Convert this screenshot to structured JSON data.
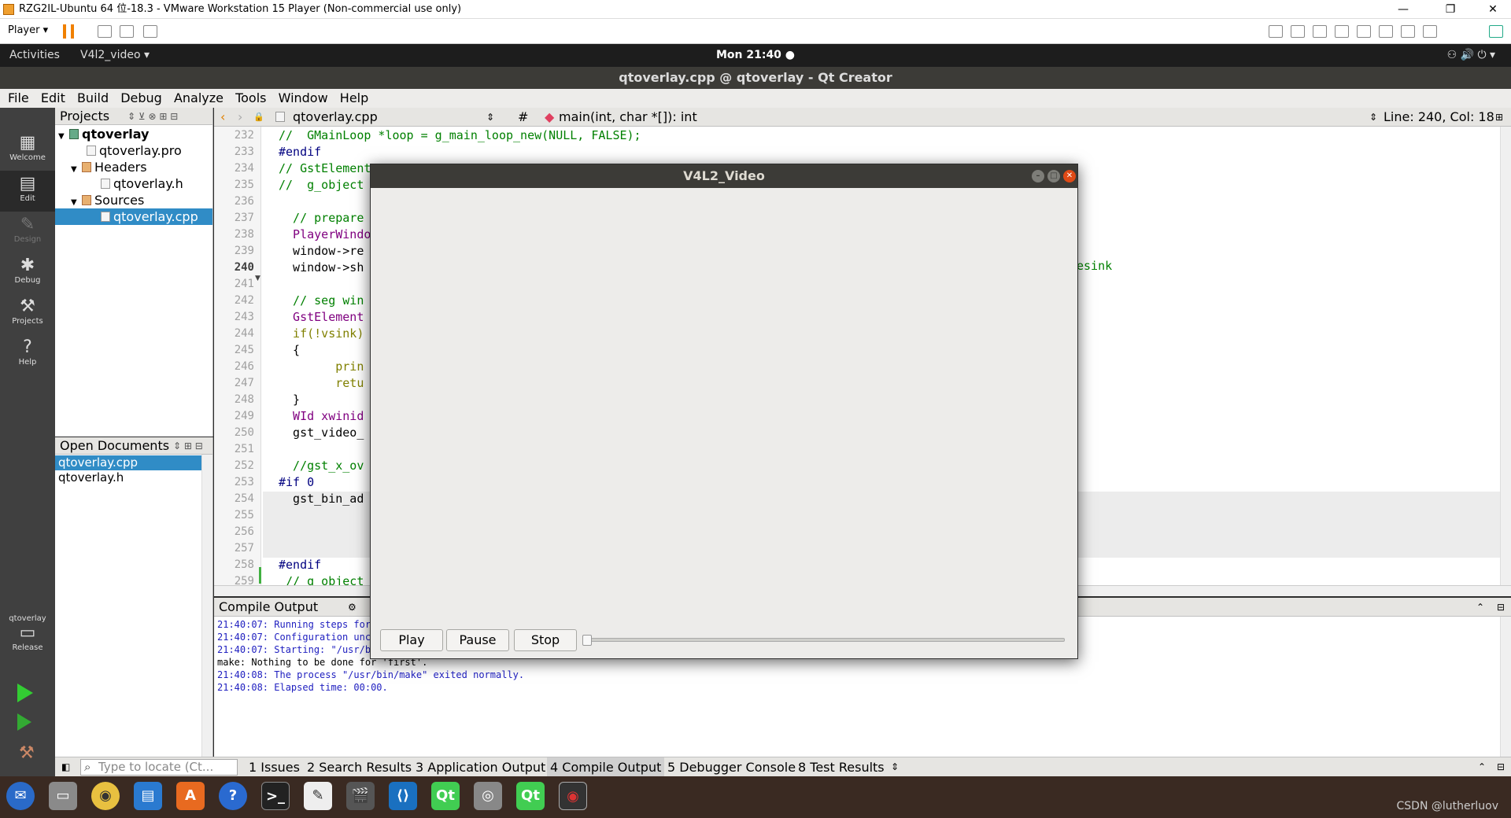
{
  "vm": {
    "title": "RZG2IL-Ubuntu 64 位-18.3 - VMware Workstation 15 Player (Non-commercial use only)",
    "player_label": "Player ▾",
    "minimize": "—",
    "restore": "❐",
    "close": "✕"
  },
  "gnome": {
    "activities": "Activities",
    "app_menu": "V4l2_video ▾",
    "clock": "Mon 21:40 ●",
    "tray": "⚇  🔊  ⏻ ▾"
  },
  "qt": {
    "window_title": "qtoverlay.cpp @ qtoverlay - Qt Creator",
    "menu": [
      "File",
      "Edit",
      "Build",
      "Debug",
      "Analyze",
      "Tools",
      "Window",
      "Help"
    ],
    "modes": [
      {
        "label": "Welcome",
        "icon": "grid-icon"
      },
      {
        "label": "Edit",
        "icon": "edit-icon"
      },
      {
        "label": "Design",
        "icon": "pencil-icon"
      },
      {
        "label": "Debug",
        "icon": "bug-icon"
      },
      {
        "label": "Projects",
        "icon": "wrench-icon"
      },
      {
        "label": "Help",
        "icon": "help-icon"
      }
    ],
    "kit": {
      "project": "qtoverlay",
      "config": "Release"
    },
    "projects_label": "Projects",
    "tree": {
      "root": "qtoverlay",
      "pro": "qtoverlay.pro",
      "headers": "Headers",
      "header_file": "qtoverlay.h",
      "sources": "Sources",
      "source_file": "qtoverlay.cpp"
    },
    "open_docs_label": "Open Documents",
    "open_docs": [
      "qtoverlay.cpp",
      "qtoverlay.h"
    ],
    "editor": {
      "file": "qtoverlay.cpp",
      "symbol_hash": "#",
      "symbol": "main(int, char *[]): int",
      "position": "Line: 240, Col: 18",
      "line_numbers": [
        "232",
        "233",
        "234",
        "235",
        "236",
        "237",
        "238",
        "239",
        "240",
        "241",
        "242",
        "243",
        "244",
        "245",
        "246",
        "247",
        "248",
        "249",
        "250",
        "251",
        "252",
        "253",
        "254",
        "255",
        "256",
        "257",
        "258",
        "259"
      ],
      "lines": [
        "//  GMainLoop *loop = g_main_loop_new(NULL, FALSE);",
        "#endif",
        "// GstElement",
        "//  g_object",
        "",
        "  // prepare",
        "  PlayerWindo",
        "  window->re",
        "  window->sh",
        "",
        "  // seg win",
        "  GstElement",
        "  if(!vsink)",
        "  {",
        "        prin",
        "        retu",
        "  }",
        "  WId xwinid",
        "  gst_video_",
        "",
        "  //gst_x_ov",
        "#if 0",
        "  gst_bin_ad",
        "",
        "",
        "",
        "#endif",
        " // g_object"
      ],
      "tail_text": "esink"
    },
    "compile_output_label": "Compile Output",
    "output_lines": [
      "21:40:07: Running steps for",
      "21:40:07: Configuration unc",
      "21:40:07: Starting: \"/usr/b",
      "make: Nothing to be done for 'first'.",
      "21:40:08: The process \"/usr/bin/make\" exited normally.",
      "21:40:08: Elapsed time: 00:00."
    ],
    "locator_placeholder": "Type to locate (Ct...",
    "output_tabs": [
      "1  Issues",
      "2  Search Results",
      "3  Application Output",
      "4  Compile Output",
      "5  Debugger Console",
      "8  Test Results"
    ]
  },
  "dialog": {
    "title": "V4L2_Video",
    "play": "Play",
    "pause": "Pause",
    "stop": "Stop",
    "progress": 0
  },
  "taskbar": {
    "apps": [
      "thunderbird-icon",
      "files-icon",
      "rhythmbox-icon",
      "writer-icon",
      "software-icon",
      "help-icon",
      "terminal-icon",
      "text-editor-icon",
      "video-icon",
      "vscode-icon",
      "qt-icon",
      "camera-icon",
      "qt-icon",
      "recorder-icon"
    ],
    "watermark": "CSDN @lutherluov"
  },
  "colors": {
    "selection": "#308cc6",
    "comment": "#008000",
    "dialog_title": "#3c3b37"
  }
}
